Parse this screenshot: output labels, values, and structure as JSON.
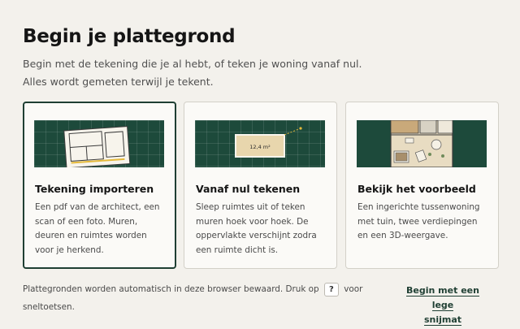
{
  "header": {
    "title": "Begin je plattegrond",
    "subtitle_line1": "Begin met de tekening die je al hebt, of teken je woning vanaf nul.",
    "subtitle_line2": "Alles wordt gemeten terwijl je tekent."
  },
  "cards": [
    {
      "title": "Tekening importeren",
      "desc": [
        "Een pdf van de architect, een",
        "scan of een foto. Muren,",
        "deuren en ruimtes worden",
        "voor je herkend."
      ],
      "selected": true
    },
    {
      "title": "Vanaf nul tekenen",
      "desc": [
        "Sleep ruimtes uit of teken",
        "muren hoek voor hoek. De",
        "oppervlakte verschijnt zodra",
        "een ruimte dicht is."
      ],
      "area_label": "12,4 m²",
      "selected": false
    },
    {
      "title": "Bekijk het voorbeeld",
      "desc": [
        "Een ingerichte tussenwoning",
        "met tuin, twee verdiepingen",
        "en een 3D-weergave."
      ],
      "selected": false
    }
  ],
  "footer": {
    "note_before": "Plattegronden worden automatisch in deze browser bewaard. Druk op",
    "shortcut_key": "?",
    "note_after": "voor",
    "note_line2": "sneltoetsen.",
    "blank_link_line1": "Begin met een lege",
    "blank_link_line2": "snijmat"
  },
  "colors": {
    "background": "#f3f1ec",
    "accent": "#1f3f33",
    "card_image_bg": "#1d4a3b"
  },
  "icons": [
    "question-key"
  ]
}
